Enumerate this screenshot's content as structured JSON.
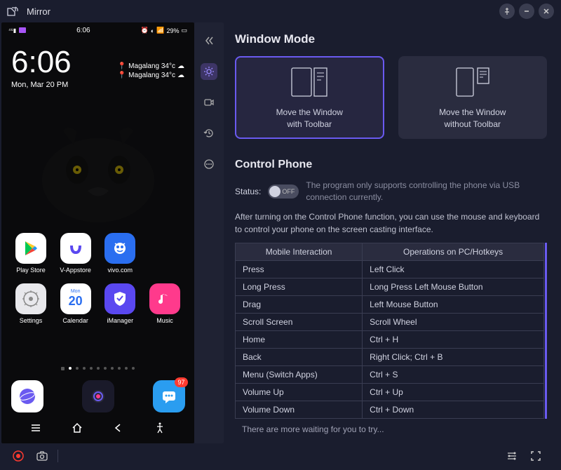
{
  "titlebar": {
    "title": "Mirror"
  },
  "phone": {
    "clock": "6:06",
    "time": "6:06",
    "date": "Mon, Mar 20 PM",
    "battery": "29%",
    "weather1": "Magalang 34°c",
    "weather2": "Magalang 34°c",
    "apps": [
      {
        "label": "Play Store",
        "bg": "#ffffff"
      },
      {
        "label": "V-Appstore",
        "bg": "#ffffff"
      },
      {
        "label": "vivo.com",
        "bg": "#2a6ef0"
      },
      {
        "label": "Settings",
        "bg": "#ffffff"
      },
      {
        "label": "Calendar",
        "bg": "#ffffff",
        "day": "20",
        "dow": "Mon"
      },
      {
        "label": "iManager",
        "bg": "#5a48f0"
      },
      {
        "label": "Music",
        "bg": "#ff3a8c"
      }
    ],
    "badge": "97"
  },
  "window_mode": {
    "title": "Window Mode",
    "card1": "Move the Window\nwith Toolbar",
    "card2": "Move the Window\nwithout Toolbar"
  },
  "control": {
    "title": "Control Phone",
    "status_label": "Status:",
    "toggle": "OFF",
    "note": "The program only supports controlling the phone via USB connection currently.",
    "desc": "After turning on the Control Phone function, you can use the mouse and keyboard to control your phone on the screen casting interface.",
    "headers": [
      "Mobile Interaction",
      "Operations on PC/Hotkeys"
    ],
    "rows": [
      [
        "Press",
        "Left Click"
      ],
      [
        "Long Press",
        "Long Press Left Mouse Button"
      ],
      [
        "Drag",
        "Left Mouse Button"
      ],
      [
        "Scroll Screen",
        "Scroll Wheel"
      ],
      [
        "Home",
        "Ctrl + H"
      ],
      [
        "Back",
        "Right Click; Ctrl + B"
      ],
      [
        "Menu (Switch Apps)",
        "Ctrl + S"
      ],
      [
        "Volume Up",
        "Ctrl + Up"
      ],
      [
        "Volume Down",
        "Ctrl + Down"
      ]
    ],
    "more": "There are more waiting for you to try..."
  }
}
